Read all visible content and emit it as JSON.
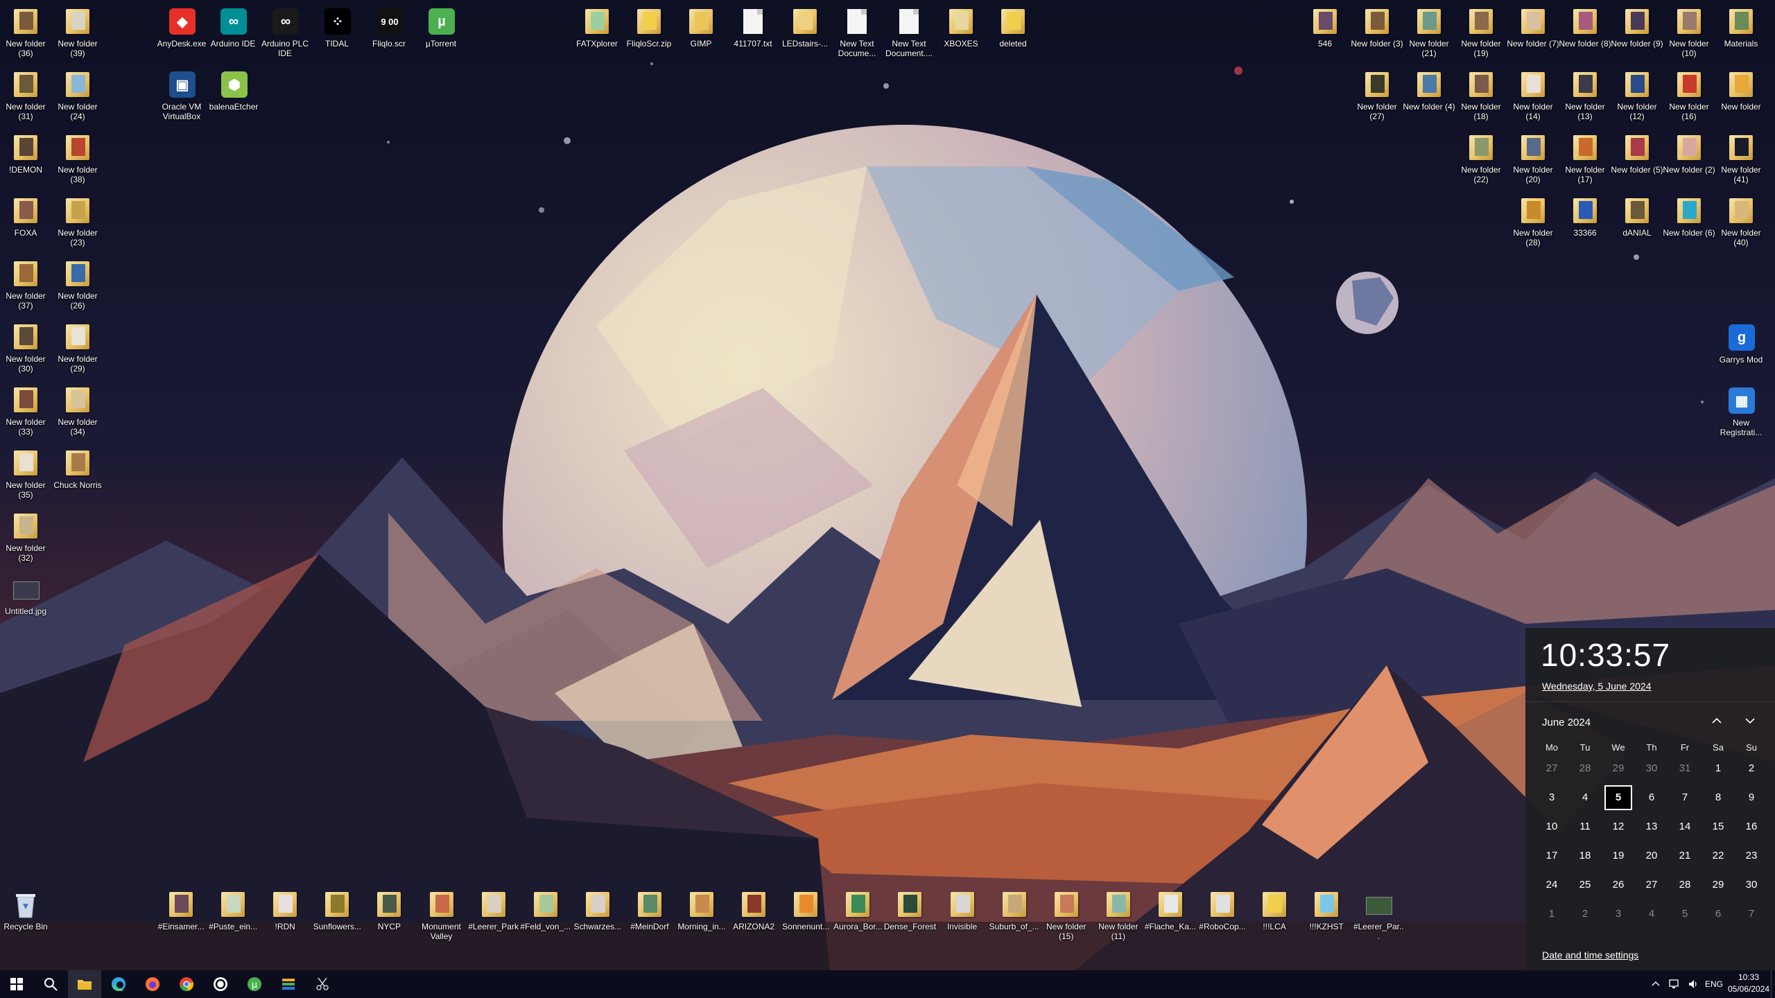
{
  "desktop": {
    "left_column": [
      {
        "label": "New folder (36)",
        "kind": "folder",
        "tint": "#7a5a3c"
      },
      {
        "label": "New folder (39)",
        "kind": "folder",
        "tint": "#d8d4c0"
      },
      {
        "label": "New folder (31)",
        "kind": "folder",
        "tint": "#6a5a3a"
      },
      {
        "label": "New folder (24)",
        "kind": "folder",
        "tint": "#8ab6d8"
      },
      {
        "label": "!DEMON",
        "kind": "folder",
        "tint": "#5a4438"
      },
      {
        "label": "New folder (38)",
        "kind": "folder",
        "tint": "#b8452e"
      },
      {
        "label": "FOXA",
        "kind": "folder",
        "tint": "#8a5a4a"
      },
      {
        "label": "New folder (23)",
        "kind": "folder",
        "tint": "#c4a34a"
      },
      {
        "label": "New folder (37)",
        "kind": "folder",
        "tint": "#9a6a3a"
      },
      {
        "label": "New folder (26)",
        "kind": "folder",
        "tint": "#3a6aa8"
      },
      {
        "label": "New folder (30)",
        "kind": "folder",
        "tint": "#5a4a3a"
      },
      {
        "label": "New folder (29)",
        "kind": "folder",
        "tint": "#e8e4d8"
      },
      {
        "label": "New folder (33)",
        "kind": "folder",
        "tint": "#7a4a3a"
      },
      {
        "label": "New folder (34)",
        "kind": "folder",
        "tint": "#d8c49a"
      },
      {
        "label": "New folder (35)",
        "kind": "folder",
        "tint": "#e8e0d0"
      },
      {
        "label": "Chuck Norris",
        "kind": "folder",
        "tint": "#a87a4a"
      },
      {
        "label": "New folder (32)",
        "kind": "folder",
        "tint": "#c8b48a"
      },
      {
        "label": "Untitled.jpg",
        "kind": "image",
        "tint": "#3a3a4a"
      }
    ],
    "top_apps": [
      {
        "label": "AnyDesk.exe",
        "kind": "app",
        "tint": "#e8302a",
        "glyph": "◆"
      },
      {
        "label": "Arduino IDE",
        "kind": "app",
        "tint": "#008f95",
        "glyph": "∞"
      },
      {
        "label": "Arduino PLC IDE",
        "kind": "app",
        "tint": "#1a1a1a",
        "glyph": "∞"
      },
      {
        "label": "TIDAL",
        "kind": "app",
        "tint": "#000000",
        "glyph": "⁘"
      },
      {
        "label": "Fliqlo.scr",
        "kind": "app",
        "tint": "#111111",
        "glyph": "9 00"
      },
      {
        "label": "µTorrent",
        "kind": "app",
        "tint": "#4caf50",
        "glyph": "µ"
      },
      {
        "label": "Oracle VM VirtualBox",
        "kind": "app",
        "tint": "#1e4e8c",
        "glyph": "▣"
      },
      {
        "label": "balenaEtcher",
        "kind": "app",
        "tint": "#8bc34a",
        "glyph": "⬢"
      }
    ],
    "top_files": [
      {
        "label": "FATXplorer",
        "kind": "folder",
        "tint": "#9ad0a0"
      },
      {
        "label": "FliqloScr.zip",
        "kind": "zip",
        "tint": "#f2cf4a"
      },
      {
        "label": "GIMP",
        "kind": "folder",
        "tint": "#eac65a"
      },
      {
        "label": "411707.txt",
        "kind": "doc",
        "tint": "#f4f4f4"
      },
      {
        "label": "LEDstairs-...",
        "kind": "folder",
        "tint": "#f0d080"
      },
      {
        "label": "New Text Docume...",
        "kind": "doc",
        "tint": "#f4f4f4"
      },
      {
        "label": "New Text Document....",
        "kind": "doc",
        "tint": "#f4f4f4"
      },
      {
        "label": "XBOXES",
        "kind": "folder",
        "tint": "#e8d8a0"
      },
      {
        "label": "deleted",
        "kind": "folder",
        "tint": "#f2cf4a"
      }
    ],
    "right_rows": [
      [
        {
          "label": "546",
          "kind": "folder",
          "tint": "#6a4a6a"
        },
        {
          "label": "New folder (3)",
          "kind": "folder",
          "tint": "#7a5a3a"
        },
        {
          "label": "New folder (21)",
          "kind": "folder",
          "tint": "#6a9a8a"
        },
        {
          "label": "New folder (19)",
          "kind": "folder",
          "tint": "#8a6a4a"
        },
        {
          "label": "New folder (7)",
          "kind": "folder",
          "tint": "#d8c0a0"
        },
        {
          "label": "New folder (8)",
          "kind": "folder",
          "tint": "#a85a7a"
        },
        {
          "label": "New folder (9)",
          "kind": "folder",
          "tint": "#4a3a5a"
        },
        {
          "label": "New folder (10)",
          "kind": "folder",
          "tint": "#9a7a6a"
        },
        {
          "label": "Materials",
          "kind": "folder",
          "tint": "#6a8a5a"
        }
      ],
      [
        {
          "label": "New folder (27)",
          "kind": "folder",
          "tint": "#3a3a2a"
        },
        {
          "label": "New folder (4)",
          "kind": "folder",
          "tint": "#4a7aa8"
        },
        {
          "label": "New folder (18)",
          "kind": "folder",
          "tint": "#7a5a4a"
        },
        {
          "label": "New folder (14)",
          "kind": "folder",
          "tint": "#e8e0d8"
        },
        {
          "label": "New folder (13)",
          "kind": "folder",
          "tint": "#3a3a4a"
        },
        {
          "label": "New folder (12)",
          "kind": "folder",
          "tint": "#2a4a8a"
        },
        {
          "label": "New folder (16)",
          "kind": "folder",
          "tint": "#c83a2a"
        },
        {
          "label": "New folder",
          "kind": "folder",
          "tint": "#e8a83a"
        }
      ],
      [
        {
          "label": "New folder (22)",
          "kind": "folder",
          "tint": "#8a9a6a"
        },
        {
          "label": "New folder (20)",
          "kind": "folder",
          "tint": "#5a6a8a"
        },
        {
          "label": "New folder (17)",
          "kind": "folder",
          "tint": "#c86a2a"
        },
        {
          "label": "New folder (5)",
          "kind": "folder",
          "tint": "#a83a4a"
        },
        {
          "label": "New folder (2)",
          "kind": "folder",
          "tint": "#d8a8a0"
        },
        {
          "label": "New folder (41)",
          "kind": "folder",
          "tint": "#1a1a2a"
        }
      ],
      [
        {
          "label": "New folder (28)",
          "kind": "folder",
          "tint": "#c88a2a"
        },
        {
          "label": "33366",
          "kind": "folder",
          "tint": "#2a5ab8"
        },
        {
          "label": "dANIAL",
          "kind": "folder",
          "tint": "#6a5a3a"
        },
        {
          "label": "New folder (6)",
          "kind": "folder",
          "tint": "#2aa8c8"
        },
        {
          "label": "New folder (40)",
          "kind": "folder",
          "tint": "#d8b87a"
        }
      ]
    ],
    "right_apps": [
      {
        "label": "Garrys Mod",
        "kind": "app",
        "tint": "#1a6ad8",
        "glyph": "g"
      },
      {
        "label": "New Registrati...",
        "kind": "app",
        "tint": "#2a7ad8",
        "glyph": "▦"
      }
    ],
    "recycle_bin": {
      "label": "Recycle Bin",
      "kind": "bin",
      "tint": "#cfd8e8"
    },
    "bottom_row": [
      {
        "label": "#Einsamer...",
        "kind": "folder",
        "tint": "#6a4a5a"
      },
      {
        "label": "#Puste_ein...",
        "kind": "folder",
        "tint": "#c8d8c0"
      },
      {
        "label": "!RDN",
        "kind": "folder",
        "tint": "#e8e0e0"
      },
      {
        "label": "Sunflowers...",
        "kind": "folder",
        "tint": "#8a7a2a"
      },
      {
        "label": "NYCP",
        "kind": "folder",
        "tint": "#4a5a4a"
      },
      {
        "label": "Monument Valley",
        "kind": "folder",
        "tint": "#c86a4a"
      },
      {
        "label": "#Leerer_Park",
        "kind": "folder",
        "tint": "#d8d0c0"
      },
      {
        "label": "#Feld_von_...",
        "kind": "folder",
        "tint": "#a8c89a"
      },
      {
        "label": "Schwarzes...",
        "kind": "folder",
        "tint": "#d8d0c8"
      },
      {
        "label": "#MeinDorf",
        "kind": "folder",
        "tint": "#5a8a6a"
      },
      {
        "label": "Morning_in...",
        "kind": "folder",
        "tint": "#c88a4a"
      },
      {
        "label": "ARIZONA2",
        "kind": "folder",
        "tint": "#8a3a2a"
      },
      {
        "label": "Sonnenunt...",
        "kind": "folder",
        "tint": "#e88a2a"
      },
      {
        "label": "Aurora_Bor...",
        "kind": "folder",
        "tint": "#3a8a5a"
      },
      {
        "label": "Dense_Forest",
        "kind": "folder",
        "tint": "#2a4a3a"
      },
      {
        "label": "Invisible",
        "kind": "folder",
        "tint": "#d8d8d8"
      },
      {
        "label": "Suburb_of_...",
        "kind": "folder",
        "tint": "#c8a87a"
      },
      {
        "label": "New folder (15)",
        "kind": "folder",
        "tint": "#c87a5a"
      },
      {
        "label": "New folder (11)",
        "kind": "folder",
        "tint": "#8ab8a8"
      },
      {
        "label": "#Flache_Ka...",
        "kind": "folder",
        "tint": "#e8e8e8"
      },
      {
        "label": "#RoboCop...",
        "kind": "folder",
        "tint": "#e0e0e0"
      },
      {
        "label": "!!!LCA",
        "kind": "folder",
        "tint": "#f2cf4a"
      },
      {
        "label": "!!!KZHST",
        "kind": "folder",
        "tint": "#7ac8e8"
      },
      {
        "label": "#Leerer_Par...",
        "kind": "image",
        "tint": "#3a5a3a"
      }
    ]
  },
  "calendar_flyout": {
    "time": "10:33:57",
    "date_long": "Wednesday, 5 June 2024",
    "month_label": "June 2024",
    "prev_icon": "chevron-up-icon",
    "next_icon": "chevron-down-icon",
    "weekdays": [
      "Mo",
      "Tu",
      "We",
      "Th",
      "Fr",
      "Sa",
      "Su"
    ],
    "weeks": [
      [
        {
          "d": "27",
          "out": true
        },
        {
          "d": "28",
          "out": true
        },
        {
          "d": "29",
          "out": true
        },
        {
          "d": "30",
          "out": true
        },
        {
          "d": "31",
          "out": true
        },
        {
          "d": "1"
        },
        {
          "d": "2"
        }
      ],
      [
        {
          "d": "3"
        },
        {
          "d": "4"
        },
        {
          "d": "5",
          "today": true
        },
        {
          "d": "6"
        },
        {
          "d": "7"
        },
        {
          "d": "8"
        },
        {
          "d": "9"
        }
      ],
      [
        {
          "d": "10"
        },
        {
          "d": "11"
        },
        {
          "d": "12"
        },
        {
          "d": "13"
        },
        {
          "d": "14"
        },
        {
          "d": "15"
        },
        {
          "d": "16"
        }
      ],
      [
        {
          "d": "17"
        },
        {
          "d": "18"
        },
        {
          "d": "19"
        },
        {
          "d": "20"
        },
        {
          "d": "21"
        },
        {
          "d": "22"
        },
        {
          "d": "23"
        }
      ],
      [
        {
          "d": "24"
        },
        {
          "d": "25"
        },
        {
          "d": "26"
        },
        {
          "d": "27"
        },
        {
          "d": "28"
        },
        {
          "d": "29"
        },
        {
          "d": "30"
        }
      ],
      [
        {
          "d": "1",
          "out": true
        },
        {
          "d": "2",
          "out": true
        },
        {
          "d": "3",
          "out": true
        },
        {
          "d": "4",
          "out": true
        },
        {
          "d": "5",
          "out": true
        },
        {
          "d": "6",
          "out": true
        },
        {
          "d": "7",
          "out": true
        }
      ]
    ],
    "settings_link": "Date and time settings"
  },
  "taskbar": {
    "buttons": [
      {
        "name": "start-button",
        "icon": "windows-icon",
        "color": "#ffffff"
      },
      {
        "name": "search-button",
        "icon": "search-icon",
        "color": "#ffffff"
      },
      {
        "name": "file-explorer-button",
        "icon": "folder-icon",
        "color": "#f2c94c"
      },
      {
        "name": "edge-button",
        "icon": "edge-icon",
        "color": "#2fa8e0"
      },
      {
        "name": "firefox-button",
        "icon": "firefox-icon",
        "color": "#ff7139"
      },
      {
        "name": "chrome-button",
        "icon": "chrome-icon",
        "color": "#34a853"
      },
      {
        "name": "ubisoft-button",
        "icon": "ubisoft-icon",
        "color": "#ffffff"
      },
      {
        "name": "utorrent-button",
        "icon": "utorrent-icon",
        "color": "#4caf50"
      },
      {
        "name": "stack-app-button",
        "icon": "stack-icon",
        "color": "#e8a83a"
      },
      {
        "name": "snip-tool-button",
        "icon": "scissors-icon",
        "color": "#c8c8c8"
      }
    ],
    "tray": {
      "overflow_icon": "chevron-up-icon",
      "network_icon": "network-icon",
      "volume_icon": "volume-icon",
      "language": "ENG",
      "time": "10:33",
      "date": "05/06/2024"
    }
  },
  "colors": {
    "sky_top": "#0e1024",
    "sky_mid": "#1c1a36",
    "horizon": "#3a2230",
    "moon": "#e8dcc0",
    "ground": "#c8734a",
    "flyout_bg": "#1e1e22",
    "taskbar_bg": "#0c0d1c"
  }
}
